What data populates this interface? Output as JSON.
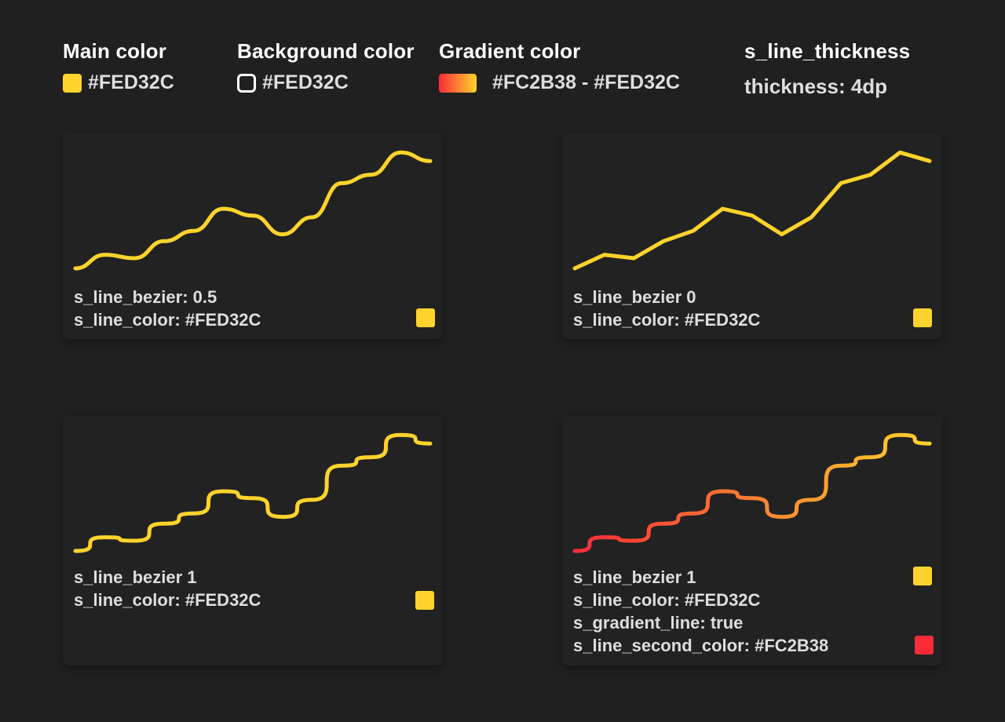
{
  "legend": {
    "main": {
      "title": "Main color",
      "value": "#FED32C",
      "color": "#FED32C"
    },
    "background": {
      "title": "Background color",
      "value": "#FED32C"
    },
    "gradient": {
      "title": "Gradient color",
      "value": "#FC2B38 - #FED32C",
      "from": "#FC2B38",
      "to": "#FED32C"
    },
    "thickness": {
      "title": "s_line_thickness",
      "value": "thickness: 4dp"
    }
  },
  "chart_data": [
    {
      "type": "line",
      "y": [
        0,
        8,
        6,
        16,
        22,
        35,
        31,
        20,
        30,
        50,
        55,
        68,
        63
      ],
      "ylim": [
        0,
        70
      ],
      "bezier": 0.5,
      "line_color": "#FED32C",
      "gradient": false,
      "labels": [
        "s_line_bezier: 0.5",
        "s_line_color: #FED32C"
      ]
    },
    {
      "type": "line",
      "y": [
        0,
        8,
        6,
        16,
        22,
        35,
        31,
        20,
        30,
        50,
        55,
        68,
        63
      ],
      "ylim": [
        0,
        70
      ],
      "bezier": 0,
      "line_color": "#FED32C",
      "gradient": false,
      "labels": [
        "s_line_bezier 0",
        "s_line_color: #FED32C"
      ]
    },
    {
      "type": "line",
      "y": [
        0,
        8,
        6,
        16,
        22,
        35,
        31,
        20,
        30,
        50,
        55,
        68,
        63
      ],
      "ylim": [
        0,
        70
      ],
      "bezier": 1,
      "line_color": "#FED32C",
      "gradient": false,
      "labels": [
        "s_line_bezier 1",
        "s_line_color: #FED32C"
      ]
    },
    {
      "type": "line",
      "y": [
        0,
        8,
        6,
        16,
        22,
        35,
        31,
        20,
        30,
        50,
        55,
        68,
        63
      ],
      "ylim": [
        0,
        70
      ],
      "bezier": 1,
      "line_color": "#FED32C",
      "gradient": true,
      "second_color": "#FC2B38",
      "labels": [
        "s_line_bezier 1",
        "s_line_color: #FED32C",
        "s_gradient_line: true",
        "s_line_second_color: #FC2B38"
      ]
    }
  ]
}
